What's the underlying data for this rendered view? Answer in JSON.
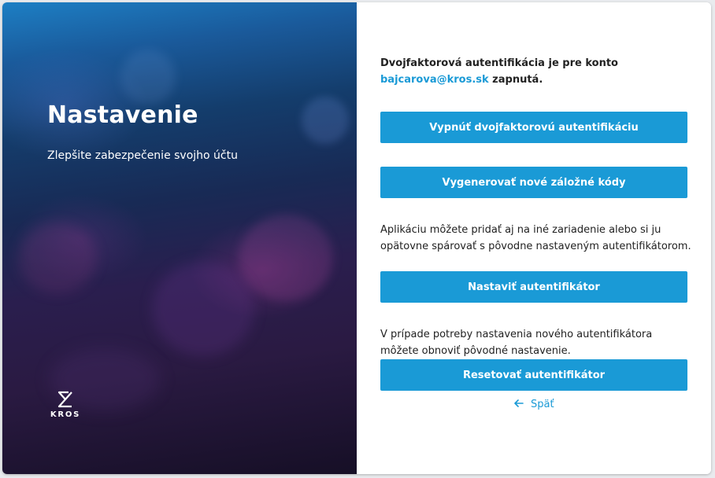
{
  "left_panel": {
    "title": "Nastavenie",
    "subtitle": "Zlepšite zabezpečenie svojho účtu",
    "logo_text": "KROS",
    "logo_icon": "kros-logo-icon"
  },
  "right_panel": {
    "status": {
      "line1": "Dvojfaktorová autentifikácia je pre konto",
      "email": "bajcarova@kros.sk",
      "suffix": " zapnutá."
    },
    "disable_button": "Vypnúť dvojfaktorovú autentifikáciu",
    "backup_codes_button": "Vygenerovať nové záložné kódy",
    "setup_text": "Aplikáciu môžete pridať aj na iné zariadenie alebo si ju opätovne spárovať s pôvodne nastaveným autentifikátorom.",
    "setup_button": "Nastaviť autentifikátor",
    "reset_text": "V prípade potreby nastavenia nového autentifikátora môžete obnoviť pôvodné nastavenie.",
    "reset_button": "Resetovať autentifikátor",
    "back_link": "Späť",
    "back_icon": "arrow-left-icon"
  },
  "colors": {
    "accent": "#1a9ad6",
    "text": "#222222",
    "panel_top": "#1d7fc4",
    "panel_bottom": "#160f26"
  }
}
